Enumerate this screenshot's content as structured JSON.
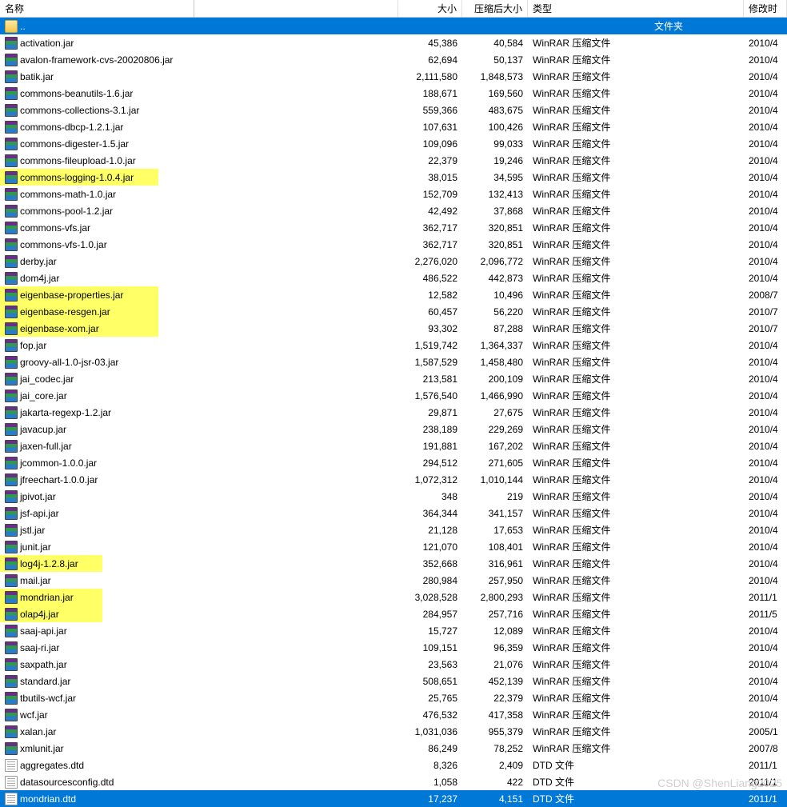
{
  "columns": {
    "name": "名称",
    "size": "大小",
    "packed": "压缩后大小",
    "type": "类型",
    "date": "修改时"
  },
  "parent_row": {
    "name": "..",
    "type_label": "文件夹"
  },
  "watermark": "CSDN @ShenLiang2025",
  "files": [
    {
      "name": "activation.jar",
      "size": "45,386",
      "packed": "40,584",
      "type": "WinRAR 压缩文件",
      "date": "2010/4",
      "icon": "rar",
      "hl": 0
    },
    {
      "name": "avalon-framework-cvs-20020806.jar",
      "size": "62,694",
      "packed": "50,137",
      "type": "WinRAR 压缩文件",
      "date": "2010/4",
      "icon": "rar",
      "hl": 0
    },
    {
      "name": "batik.jar",
      "size": "2,111,580",
      "packed": "1,848,573",
      "type": "WinRAR 压缩文件",
      "date": "2010/4",
      "icon": "rar",
      "hl": 0
    },
    {
      "name": "commons-beanutils-1.6.jar",
      "size": "188,671",
      "packed": "169,560",
      "type": "WinRAR 压缩文件",
      "date": "2010/4",
      "icon": "rar",
      "hl": 0
    },
    {
      "name": "commons-collections-3.1.jar",
      "size": "559,366",
      "packed": "483,675",
      "type": "WinRAR 压缩文件",
      "date": "2010/4",
      "icon": "rar",
      "hl": 0
    },
    {
      "name": "commons-dbcp-1.2.1.jar",
      "size": "107,631",
      "packed": "100,426",
      "type": "WinRAR 压缩文件",
      "date": "2010/4",
      "icon": "rar",
      "hl": 0
    },
    {
      "name": "commons-digester-1.5.jar",
      "size": "109,096",
      "packed": "99,033",
      "type": "WinRAR 压缩文件",
      "date": "2010/4",
      "icon": "rar",
      "hl": 0
    },
    {
      "name": "commons-fileupload-1.0.jar",
      "size": "22,379",
      "packed": "19,246",
      "type": "WinRAR 压缩文件",
      "date": "2010/4",
      "icon": "rar",
      "hl": 0
    },
    {
      "name": "commons-logging-1.0.4.jar",
      "size": "38,015",
      "packed": "34,595",
      "type": "WinRAR 压缩文件",
      "date": "2010/4",
      "icon": "rar",
      "hl": 198
    },
    {
      "name": "commons-math-1.0.jar",
      "size": "152,709",
      "packed": "132,413",
      "type": "WinRAR 压缩文件",
      "date": "2010/4",
      "icon": "rar",
      "hl": 0
    },
    {
      "name": "commons-pool-1.2.jar",
      "size": "42,492",
      "packed": "37,868",
      "type": "WinRAR 压缩文件",
      "date": "2010/4",
      "icon": "rar",
      "hl": 0
    },
    {
      "name": "commons-vfs.jar",
      "size": "362,717",
      "packed": "320,851",
      "type": "WinRAR 压缩文件",
      "date": "2010/4",
      "icon": "rar",
      "hl": 0
    },
    {
      "name": "commons-vfs-1.0.jar",
      "size": "362,717",
      "packed": "320,851",
      "type": "WinRAR 压缩文件",
      "date": "2010/4",
      "icon": "rar",
      "hl": 0
    },
    {
      "name": "derby.jar",
      "size": "2,276,020",
      "packed": "2,096,772",
      "type": "WinRAR 压缩文件",
      "date": "2010/4",
      "icon": "rar",
      "hl": 0
    },
    {
      "name": "dom4j.jar",
      "size": "486,522",
      "packed": "442,873",
      "type": "WinRAR 压缩文件",
      "date": "2010/4",
      "icon": "rar",
      "hl": 0
    },
    {
      "name": "eigenbase-properties.jar",
      "size": "12,582",
      "packed": "10,496",
      "type": "WinRAR 压缩文件",
      "date": "2008/7",
      "icon": "rar",
      "hl": 198
    },
    {
      "name": "eigenbase-resgen.jar",
      "size": "60,457",
      "packed": "56,220",
      "type": "WinRAR 压缩文件",
      "date": "2010/7",
      "icon": "rar",
      "hl": 198
    },
    {
      "name": "eigenbase-xom.jar",
      "size": "93,302",
      "packed": "87,288",
      "type": "WinRAR 压缩文件",
      "date": "2010/7",
      "icon": "rar",
      "hl": 198
    },
    {
      "name": "fop.jar",
      "size": "1,519,742",
      "packed": "1,364,337",
      "type": "WinRAR 压缩文件",
      "date": "2010/4",
      "icon": "rar",
      "hl": 0
    },
    {
      "name": "groovy-all-1.0-jsr-03.jar",
      "size": "1,587,529",
      "packed": "1,458,480",
      "type": "WinRAR 压缩文件",
      "date": "2010/4",
      "icon": "rar",
      "hl": 0
    },
    {
      "name": "jai_codec.jar",
      "size": "213,581",
      "packed": "200,109",
      "type": "WinRAR 压缩文件",
      "date": "2010/4",
      "icon": "rar",
      "hl": 0
    },
    {
      "name": "jai_core.jar",
      "size": "1,576,540",
      "packed": "1,466,990",
      "type": "WinRAR 压缩文件",
      "date": "2010/4",
      "icon": "rar",
      "hl": 0
    },
    {
      "name": "jakarta-regexp-1.2.jar",
      "size": "29,871",
      "packed": "27,675",
      "type": "WinRAR 压缩文件",
      "date": "2010/4",
      "icon": "rar",
      "hl": 0
    },
    {
      "name": "javacup.jar",
      "size": "238,189",
      "packed": "229,269",
      "type": "WinRAR 压缩文件",
      "date": "2010/4",
      "icon": "rar",
      "hl": 0
    },
    {
      "name": "jaxen-full.jar",
      "size": "191,881",
      "packed": "167,202",
      "type": "WinRAR 压缩文件",
      "date": "2010/4",
      "icon": "rar",
      "hl": 0
    },
    {
      "name": "jcommon-1.0.0.jar",
      "size": "294,512",
      "packed": "271,605",
      "type": "WinRAR 压缩文件",
      "date": "2010/4",
      "icon": "rar",
      "hl": 0
    },
    {
      "name": "jfreechart-1.0.0.jar",
      "size": "1,072,312",
      "packed": "1,010,144",
      "type": "WinRAR 压缩文件",
      "date": "2010/4",
      "icon": "rar",
      "hl": 0
    },
    {
      "name": "jpivot.jar",
      "size": "348",
      "packed": "219",
      "type": "WinRAR 压缩文件",
      "date": "2010/4",
      "icon": "rar",
      "hl": 0
    },
    {
      "name": "jsf-api.jar",
      "size": "364,344",
      "packed": "341,157",
      "type": "WinRAR 压缩文件",
      "date": "2010/4",
      "icon": "rar",
      "hl": 0
    },
    {
      "name": "jstl.jar",
      "size": "21,128",
      "packed": "17,653",
      "type": "WinRAR 压缩文件",
      "date": "2010/4",
      "icon": "rar",
      "hl": 0
    },
    {
      "name": "junit.jar",
      "size": "121,070",
      "packed": "108,401",
      "type": "WinRAR 压缩文件",
      "date": "2010/4",
      "icon": "rar",
      "hl": 0
    },
    {
      "name": "log4j-1.2.8.jar",
      "size": "352,668",
      "packed": "316,961",
      "type": "WinRAR 压缩文件",
      "date": "2010/4",
      "icon": "rar",
      "hl": 128
    },
    {
      "name": "mail.jar",
      "size": "280,984",
      "packed": "257,950",
      "type": "WinRAR 压缩文件",
      "date": "2010/4",
      "icon": "rar",
      "hl": 0
    },
    {
      "name": "mondrian.jar",
      "size": "3,028,528",
      "packed": "2,800,293",
      "type": "WinRAR 压缩文件",
      "date": "2011/1",
      "icon": "rar",
      "hl": 128
    },
    {
      "name": "olap4j.jar",
      "size": "284,957",
      "packed": "257,716",
      "type": "WinRAR 压缩文件",
      "date": "2011/5",
      "icon": "rar",
      "hl": 128
    },
    {
      "name": "saaj-api.jar",
      "size": "15,727",
      "packed": "12,089",
      "type": "WinRAR 压缩文件",
      "date": "2010/4",
      "icon": "rar",
      "hl": 0
    },
    {
      "name": "saaj-ri.jar",
      "size": "109,151",
      "packed": "96,359",
      "type": "WinRAR 压缩文件",
      "date": "2010/4",
      "icon": "rar",
      "hl": 0
    },
    {
      "name": "saxpath.jar",
      "size": "23,563",
      "packed": "21,076",
      "type": "WinRAR 压缩文件",
      "date": "2010/4",
      "icon": "rar",
      "hl": 0
    },
    {
      "name": "standard.jar",
      "size": "508,651",
      "packed": "452,139",
      "type": "WinRAR 压缩文件",
      "date": "2010/4",
      "icon": "rar",
      "hl": 0
    },
    {
      "name": "tbutils-wcf.jar",
      "size": "25,765",
      "packed": "22,379",
      "type": "WinRAR 压缩文件",
      "date": "2010/4",
      "icon": "rar",
      "hl": 0
    },
    {
      "name": "wcf.jar",
      "size": "476,532",
      "packed": "417,358",
      "type": "WinRAR 压缩文件",
      "date": "2010/4",
      "icon": "rar",
      "hl": 0
    },
    {
      "name": "xalan.jar",
      "size": "1,031,036",
      "packed": "955,379",
      "type": "WinRAR 压缩文件",
      "date": "2005/1",
      "icon": "rar",
      "hl": 0
    },
    {
      "name": "xmlunit.jar",
      "size": "86,249",
      "packed": "78,252",
      "type": "WinRAR 压缩文件",
      "date": "2007/8",
      "icon": "rar",
      "hl": 0
    },
    {
      "name": "aggregates.dtd",
      "size": "8,326",
      "packed": "2,409",
      "type": "DTD 文件",
      "date": "2011/1",
      "icon": "dtd",
      "hl": 0
    },
    {
      "name": "datasourcesconfig.dtd",
      "size": "1,058",
      "packed": "422",
      "type": "DTD 文件",
      "date": "2011/1",
      "icon": "dtd",
      "hl": 0
    },
    {
      "name": "mondrian.dtd",
      "size": "17,237",
      "packed": "4,151",
      "type": "DTD 文件",
      "date": "2011/1",
      "icon": "dtd",
      "hl": 0,
      "selected": true
    }
  ]
}
